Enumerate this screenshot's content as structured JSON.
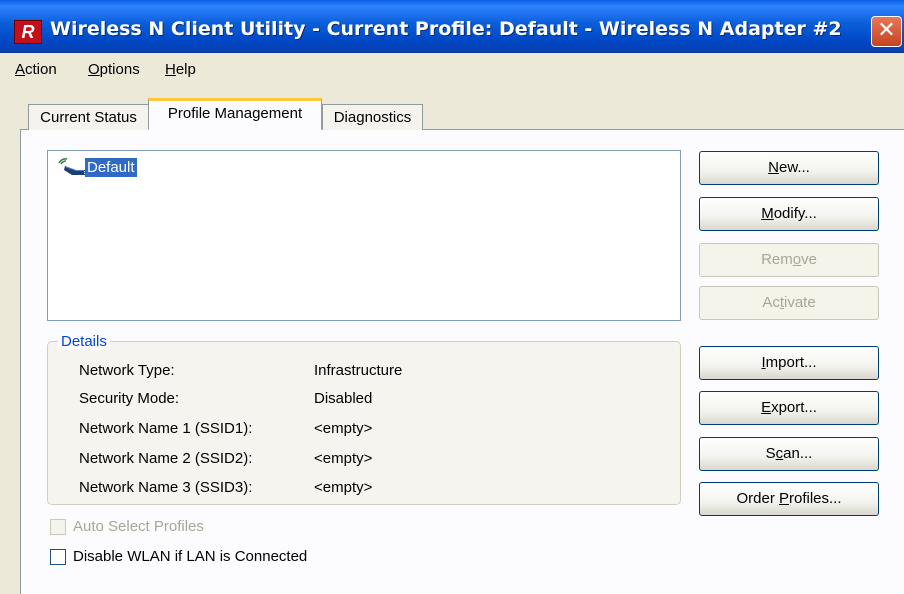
{
  "window": {
    "app_icon_letter": "R",
    "title": "Wireless N Client Utility - Current Profile: Default - Wireless N Adapter #2",
    "close_glyph": "✕"
  },
  "menu": {
    "action": {
      "mnemonic": "A",
      "rest": "ction"
    },
    "options": {
      "mnemonic": "O",
      "rest": "ptions"
    },
    "help": {
      "mnemonic": "H",
      "rest": "elp"
    }
  },
  "tabs": {
    "current_status": "Current Status",
    "profile_management": "Profile Management",
    "diagnostics": "Diagnostics"
  },
  "profiles": {
    "items": [
      {
        "name": "Default",
        "icon": "wireless-signal-icon",
        "selected": true
      }
    ]
  },
  "buttons": {
    "new": {
      "mnemonic": "N",
      "rest": "ew..."
    },
    "modify": {
      "mnemonic": "M",
      "rest": "odify..."
    },
    "remove": {
      "pre": "Rem",
      "mnemonic": "o",
      "rest": "ve"
    },
    "activate": {
      "pre": "Ac",
      "mnemonic": "t",
      "rest": "ivate"
    },
    "import": {
      "mnemonic": "I",
      "rest": "mport..."
    },
    "export": {
      "mnemonic": "E",
      "rest": "xport..."
    },
    "scan": {
      "pre": "S",
      "mnemonic": "c",
      "rest": "an..."
    },
    "order_profiles": {
      "pre": "Order ",
      "mnemonic": "P",
      "rest": "rofiles..."
    }
  },
  "details": {
    "legend": "Details",
    "rows": [
      {
        "label": "Network Type:",
        "value": "Infrastructure"
      },
      {
        "label": "Security Mode:",
        "value": "Disabled"
      },
      {
        "label": "Network Name 1 (SSID1):",
        "value": "<empty>"
      },
      {
        "label": "Network Name 2 (SSID2):",
        "value": "<empty>"
      },
      {
        "label": "Network Name 3 (SSID3):",
        "value": "<empty>"
      }
    ]
  },
  "checkboxes": {
    "auto_select": {
      "label": "Auto Select Profiles",
      "checked": false,
      "enabled": false
    },
    "disable_wlan": {
      "label": "Disable WLAN if LAN is Connected",
      "checked": false,
      "enabled": true
    }
  },
  "colors": {
    "title_blue": "#0b5ed9",
    "selection": "#316ac5",
    "tab_highlight": "#ffc83c",
    "legend_text": "#0046d5"
  }
}
